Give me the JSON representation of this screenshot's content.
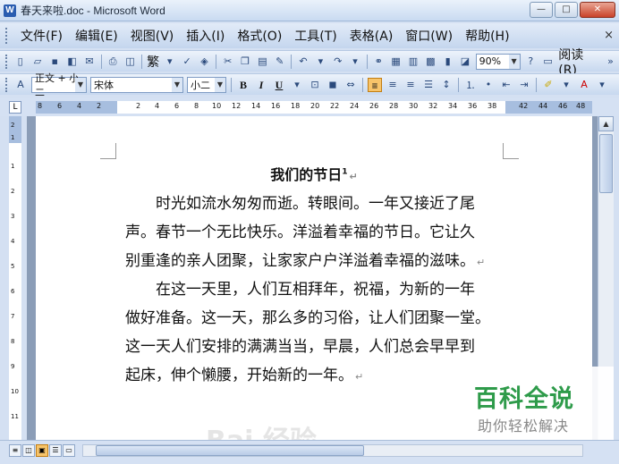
{
  "window": {
    "title": "春天来啦.doc - Microsoft Word",
    "app_icon": "W",
    "min": "—",
    "max": "□",
    "close": "✕"
  },
  "menubar": {
    "items": [
      "文件(F)",
      "编辑(E)",
      "视图(V)",
      "插入(I)",
      "格式(O)",
      "工具(T)",
      "表格(A)",
      "窗口(W)",
      "帮助(H)"
    ],
    "close": "×"
  },
  "standard_toolbar": {
    "traditional_label": "繁",
    "zoom": "90%",
    "read_label": "阅读(R)"
  },
  "format_toolbar": {
    "style": "正文 + 小二",
    "font": "宋体",
    "size": "小二",
    "bold": "B",
    "italic": "I",
    "underline": "U"
  },
  "ruler": {
    "ticks": [
      "8",
      "6",
      "4",
      "2",
      "2",
      "4",
      "6",
      "8",
      "10",
      "12",
      "14",
      "16",
      "18",
      "20",
      "22",
      "24",
      "26",
      "28",
      "30",
      "32",
      "34",
      "36",
      "38",
      "42",
      "44",
      "46",
      "48"
    ]
  },
  "vruler": {
    "ticks": [
      "2",
      "1",
      "1",
      "2",
      "3",
      "4",
      "5",
      "6",
      "7",
      "8",
      "9",
      "10",
      "11"
    ]
  },
  "document": {
    "title": "我们的节日",
    "title_mark": "1",
    "paragraph1": [
      "时光如流水匆匆而逝。转眼间。一年又接近了尾",
      "声。春节一个无比快乐。洋溢着幸福的节日。它让久",
      "别重逢的亲人团聚，让家家户户洋溢着幸福的滋味。"
    ],
    "paragraph2": [
      "在这一天里，人们互相拜年，祝福，为新的一年",
      "做好准备。这一天，那么多的习俗，让人们团聚一堂。",
      "这一天人们安排的满满当当，早晨，人们总会早早到",
      "起床，伸个懒腰，开始新的一年。"
    ],
    "para_mark": "↵"
  },
  "watermark": {
    "main": "百科全说",
    "sub": "助你轻松解决",
    "bg": "Bai 经验"
  },
  "colors": {
    "watermark_green": "#2e9b4a",
    "active_button": "#f7c46a"
  }
}
